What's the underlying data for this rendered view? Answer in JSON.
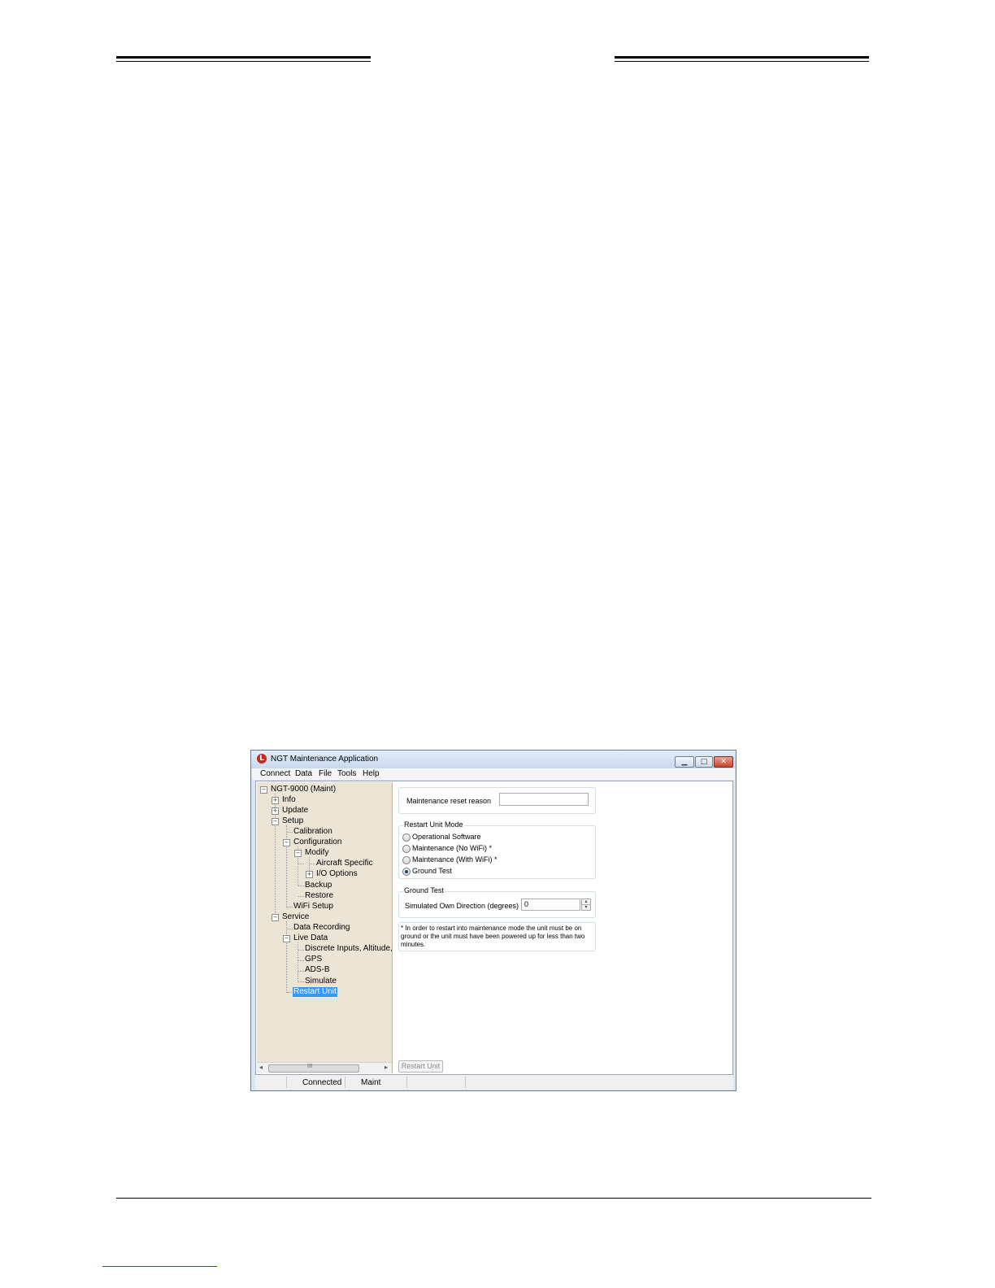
{
  "window": {
    "title": "NGT Maintenance Application",
    "icon_letter": "L",
    "minimize_glyph": "▁",
    "maximize_glyph": "□",
    "close_glyph": "✕"
  },
  "menu": [
    "Connect",
    "Data",
    "File",
    "Tools",
    "Help"
  ],
  "tree": {
    "root": "NGT-9000 (Maint)",
    "info": "Info",
    "update": "Update",
    "setup": "Setup",
    "calibration": "Calibration",
    "configuration": "Configuration",
    "modify": "Modify",
    "aircraft_specific": "Aircraft Specific",
    "io_options": "I/O Options",
    "backup": "Backup",
    "restore": "Restore",
    "wifi_setup": "WiFi Setup",
    "service": "Service",
    "data_recording": "Data Recording",
    "live_data": "Live Data",
    "discrete": "Discrete Inputs, Altitude, an",
    "gps": "GPS",
    "adsb": "ADS-B",
    "simulate": "Simulate",
    "restart_unit": "Restart Unit",
    "plus": "+",
    "minus": "−"
  },
  "scrollbar": {
    "left_arrow": "◂",
    "right_arrow": "▸",
    "grip": "III"
  },
  "panel": {
    "reset_reason_label": "Maintenance reset reason",
    "reset_reason_value": "",
    "restart_mode_title": "Restart Unit Mode",
    "modes": [
      "Operational Software",
      "Maintenance (No WiFi) *",
      "Maintenance (With WiFi) *",
      "Ground Test"
    ],
    "selected_mode": "Ground Test",
    "ground_test_title": "Ground Test",
    "direction_label": "Simulated Own Direction (degrees)",
    "direction_value": "0",
    "spin_up": "▴",
    "spin_down": "▾",
    "note": "* In order to restart into maintenance mode the unit must be on ground or the unit must have been powered up for less than two minutes.",
    "restart_button": "Restart Unit"
  },
  "status": {
    "connection": "Connected",
    "mode": "Maint"
  }
}
